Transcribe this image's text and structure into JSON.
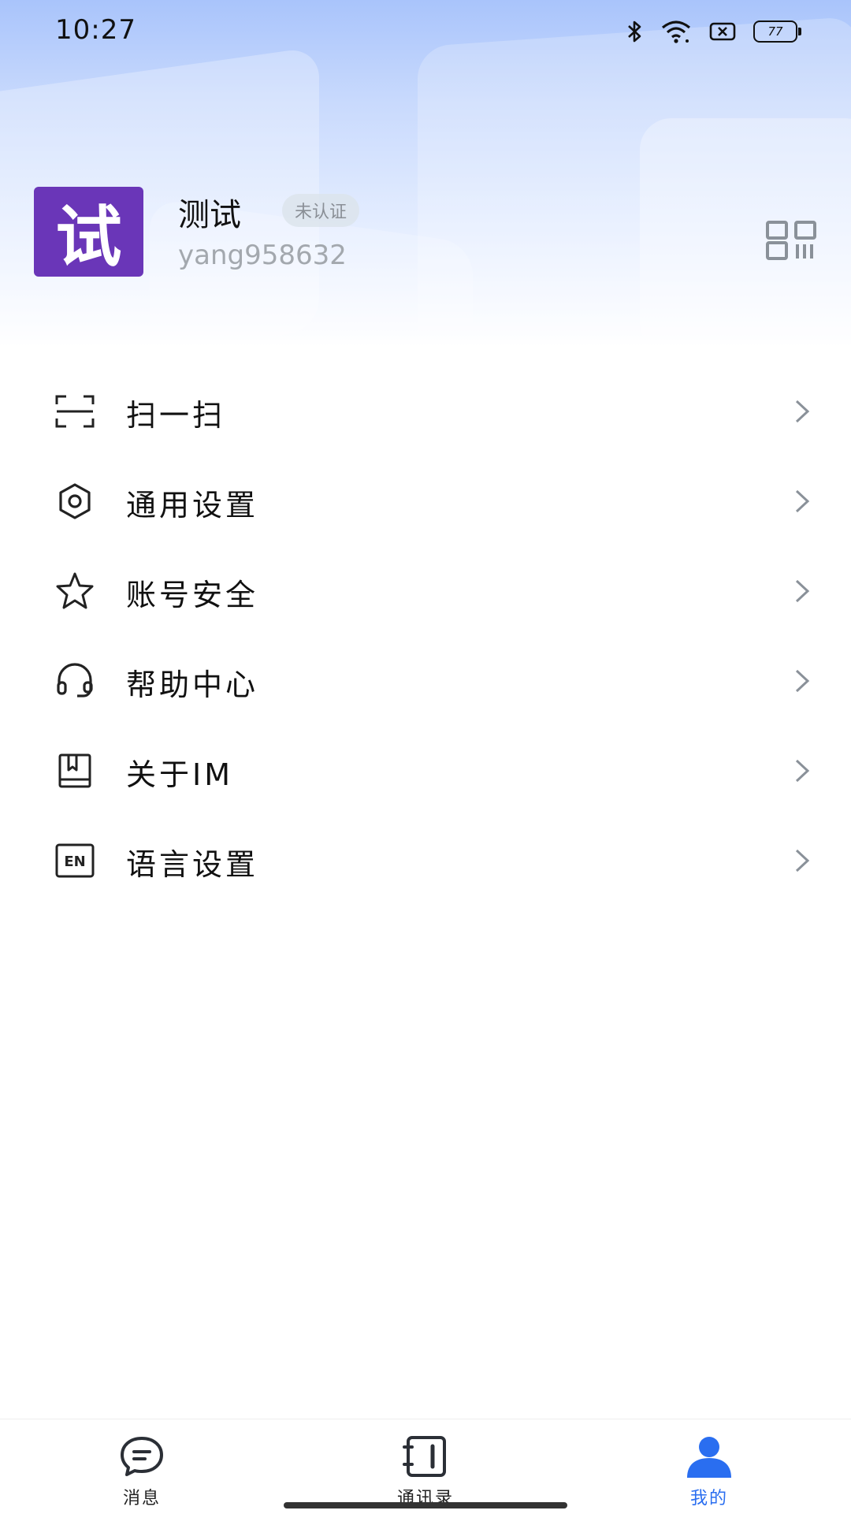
{
  "status_bar": {
    "time": "10:27",
    "battery": "77",
    "icons": [
      "bluetooth-icon",
      "wifi-icon",
      "sim-off-icon",
      "battery-icon"
    ]
  },
  "profile": {
    "avatar_text": "试",
    "avatar_color": "#6a36b8",
    "name": "测试",
    "badge": "未认证",
    "user_id": "yang958632",
    "qr_icon": "qr-code-icon"
  },
  "menu": {
    "items": [
      {
        "label": "扫一扫",
        "icon": "scan-icon"
      },
      {
        "label": "通用设置",
        "icon": "settings-hexagon-icon"
      },
      {
        "label": "账号安全",
        "icon": "star-icon"
      },
      {
        "label": "帮助中心",
        "icon": "headset-icon"
      },
      {
        "label": "关于IM",
        "icon": "book-icon"
      },
      {
        "label": "语言设置",
        "icon": "language-en-icon"
      }
    ]
  },
  "tabs": [
    {
      "label": "消息",
      "icon": "chat-icon",
      "active": false
    },
    {
      "label": "通讯录",
      "icon": "contacts-icon",
      "active": false
    },
    {
      "label": "我的",
      "icon": "person-icon",
      "active": true
    }
  ],
  "colors": {
    "accent": "#2a6ef0",
    "header_top": "#a9c4fb"
  }
}
